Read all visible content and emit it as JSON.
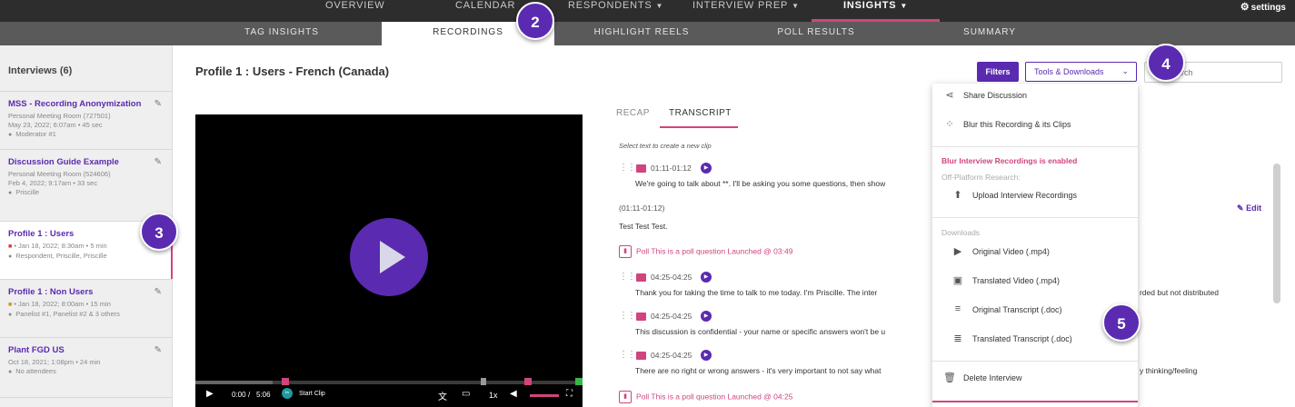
{
  "topnav": {
    "items": [
      "OVERVIEW",
      "CALENDAR",
      "RESPONDENTS",
      "INTERVIEW PREP",
      "INSIGHTS"
    ],
    "settings_label": "settings"
  },
  "subnav": {
    "items": [
      "TAG INSIGHTS",
      "RECORDINGS",
      "HIGHLIGHT REELS",
      "POLL RESULTS",
      "SUMMARY"
    ]
  },
  "sidebar": {
    "heading": "Interviews (6)",
    "interviews": [
      {
        "name": "MSS - Recording Anonymization",
        "line1": "Personal Meeting Room (727501)",
        "line2": "May 23, 2022; 6:07am • 45 sec",
        "who": "Moderator #1"
      },
      {
        "name": "Discussion Guide Example",
        "line1": "Personal Meeting Room (524606)",
        "line2": "Feb 4, 2022; 9:17am • 33 sec",
        "who": "Priscille"
      },
      {
        "name": "Profile 1 : Users",
        "line1": "• Jan 18, 2022; 8:30am • 5 min",
        "who": "Respondent, Priscille, Priscille"
      },
      {
        "name": "Profile 1 : Non Users",
        "line1": "• Jan 18, 2022; 8:00am • 15 min",
        "who": "Panelist #1, Panelist #2 & 3 others"
      },
      {
        "name": "Plant FGD US",
        "line1": "Oct 18, 2021; 1:08pm • 24 min",
        "who": "No attendees"
      }
    ]
  },
  "main": {
    "title": "Profile 1 : Users - French (Canada)",
    "filters_label": "Filters",
    "tools_label": "Tools & Downloads",
    "search_placeholder": "Search"
  },
  "video": {
    "time_current": "0:00",
    "time_total": "5:06",
    "start_clip": "Start Clip",
    "speed": "1x"
  },
  "tabs": [
    "RECAP",
    "TRANSCRIPT"
  ],
  "transcript": {
    "hint": "Select text to create a new clip",
    "edit_label": "Edit",
    "segments": [
      {
        "time": "01:11-01:12",
        "text": "We're going to talk about **. I'll be asking you some questions, then show"
      },
      {
        "time_plain": "(01:11-01:12)",
        "text": "Test Test Test."
      },
      {
        "poll": "Poll This is a poll question Launched @ 03:49"
      },
      {
        "time": "04:25-04:25",
        "text": "Thank you for taking the time to talk to me today. I'm Priscille. The inter",
        "tail": "rded but not distributed"
      },
      {
        "time": "04:25-04:25",
        "text": "This discussion is confidential - your name or specific answers won't be u"
      },
      {
        "time": "04:25-04:25",
        "text": "There are no right or wrong answers - it's very important to not say what",
        "tail": "y thinking/feeling"
      },
      {
        "poll": "Poll This is a poll question Launched @ 04:25"
      }
    ]
  },
  "menu": {
    "share": "Share Discussion",
    "blur": "Blur this Recording & its Clips",
    "blur_enabled": "Blur Interview Recordings is enabled",
    "off_platform": "Off-Platform Research:",
    "upload": "Upload Interview Recordings",
    "downloads_heading": "Downloads",
    "downloads": [
      "Original Video (.mp4)",
      "Translated Video (.mp4)",
      "Original Transcript (.doc)",
      "Translated Transcript (.doc)"
    ],
    "delete": "Delete Interview"
  },
  "badges": [
    "2",
    "3",
    "4",
    "5"
  ],
  "colors": {
    "accent": "#5a2bb0",
    "pink": "#d0457e",
    "nav": "#2d2d2d",
    "subnav": "#5a5a5a"
  }
}
